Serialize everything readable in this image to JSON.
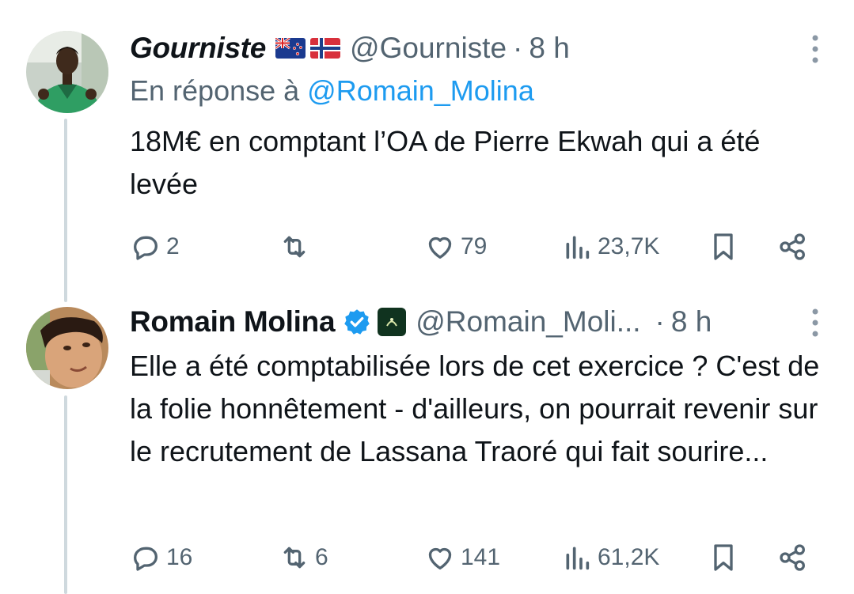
{
  "tweets": [
    {
      "author_name": "Gourniste",
      "handle": "@Gourniste",
      "separator": "·",
      "time": "8 h",
      "flags": [
        "new-zealand-flag",
        "norway-flag"
      ],
      "reply_to_label": "En réponse à",
      "reply_to_handle": "@Romain_Molina",
      "text": "18M€ en comptant l’OA de Pierre Ekwah qui a été levée",
      "replies": "2",
      "retweets": "",
      "likes": "79",
      "views": "23,7K"
    },
    {
      "author_name": "Romain Molina",
      "handle": "@Romain_Moli...",
      "separator": "·",
      "time": "8 h",
      "verified": true,
      "text": "Elle a été comptabilisée lors de cet exercice ? C'est de la folie honnêtement - d'ailleurs, on pourrait revenir sur le recrutement de Lassana Traoré qui fait sourire...",
      "replies": "16",
      "retweets": "6",
      "likes": "141",
      "views": "61,2K"
    }
  ],
  "colors": {
    "text": "#0f1419",
    "secondary": "#536471",
    "link": "#1d9bf0",
    "thread_line": "#cfd9de"
  },
  "icons": [
    "reply-icon",
    "retweet-icon",
    "like-icon",
    "views-icon",
    "bookmark-icon",
    "share-icon",
    "more-icon",
    "verified-badge-icon"
  ]
}
